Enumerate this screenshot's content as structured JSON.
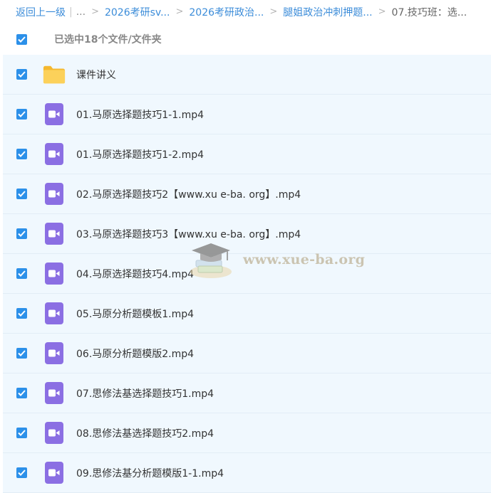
{
  "breadcrumb": {
    "back": "返回上一级",
    "ellipsis": "...",
    "items": [
      "2026考研sv...",
      "2026考研政治...",
      "腿姐政治冲刺押题..."
    ],
    "current": "07.技巧班：选..."
  },
  "selection": {
    "summary": "已选中18个文件/文件夹"
  },
  "files": [
    {
      "name": "课件讲义",
      "type": "folder",
      "checked": true
    },
    {
      "name": "01.马原选择题技巧1-1.mp4",
      "type": "video",
      "checked": true
    },
    {
      "name": "01.马原选择题技巧1-2.mp4",
      "type": "video",
      "checked": true
    },
    {
      "name": "02.马原选择题技巧2【www.xu e-ba. org】.mp4",
      "type": "video",
      "checked": true
    },
    {
      "name": "03.马原选择题技巧3【www.xu e-ba. org】.mp4",
      "type": "video",
      "checked": true
    },
    {
      "name": "04.马原选择题技巧4.mp4",
      "type": "video",
      "checked": true
    },
    {
      "name": "05.马原分析题模板1.mp4",
      "type": "video",
      "checked": true
    },
    {
      "name": "06.马原分析题模版2.mp4",
      "type": "video",
      "checked": true
    },
    {
      "name": "07.思修法基选择题技巧1.mp4",
      "type": "video",
      "checked": true
    },
    {
      "name": "08.思修法基选择题技巧2.mp4",
      "type": "video",
      "checked": true
    },
    {
      "name": "09.思修法基分析题模版1-1.mp4",
      "type": "video",
      "checked": true
    }
  ],
  "watermark": {
    "text": "www.xue-ba.org"
  },
  "icons": {
    "folder": "folder-icon",
    "video": "video-file-icon",
    "checkbox": "checkbox-checked-icon"
  },
  "colors": {
    "accent": "#2c90e9",
    "link": "#3b8cd9",
    "video_icon": "#8b6fe3",
    "folder_icon": "#f9c63e",
    "row_bg": "#f0f8fe"
  }
}
